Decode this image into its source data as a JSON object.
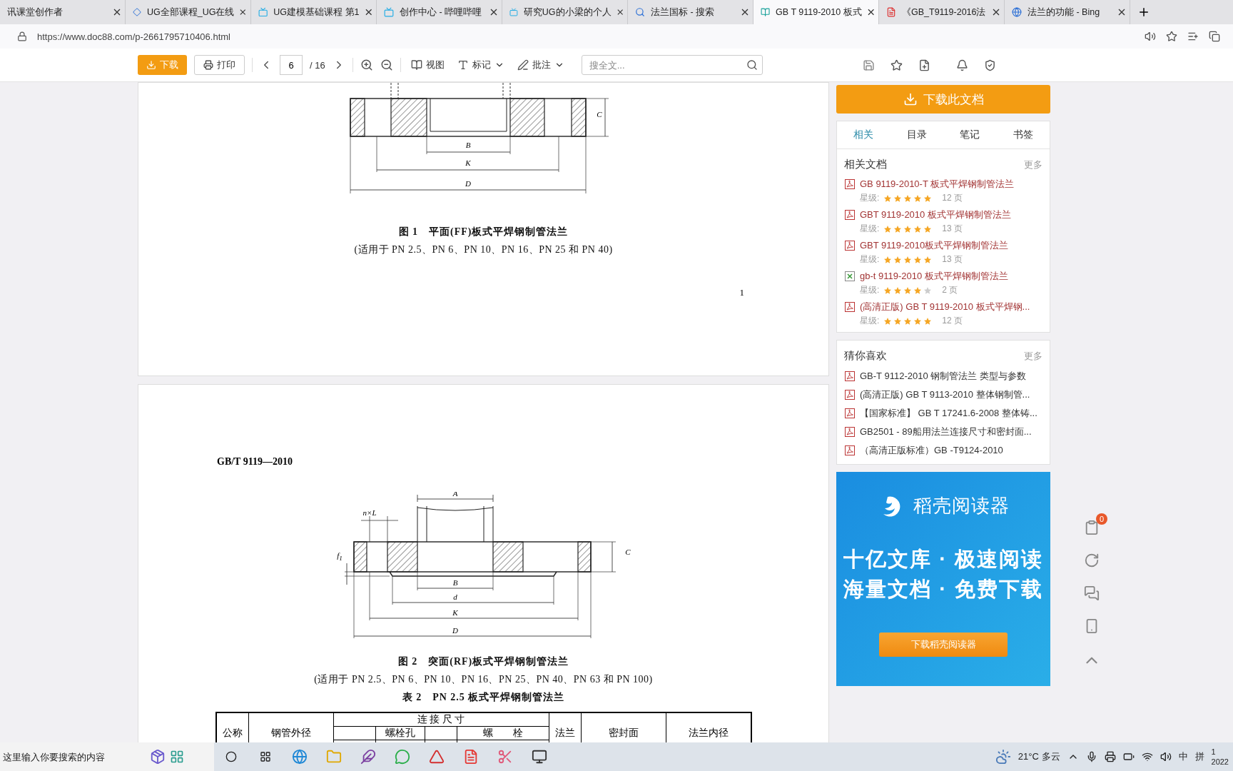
{
  "browser_tabs": [
    {
      "title": "讯课堂创作者",
      "kind": "plain",
      "selected": false
    },
    {
      "title": "UG全部课程_UG在线",
      "kind": "course",
      "selected": false
    },
    {
      "title": "UG建模基础课程 第1",
      "kind": "video",
      "selected": false
    },
    {
      "title": "创作中心 - 哔哩哔哩",
      "kind": "video",
      "selected": false
    },
    {
      "title": "研究UG的小梁的个人",
      "kind": "video",
      "selected": false
    },
    {
      "title": "法兰国标 - 搜索",
      "kind": "search",
      "selected": false
    },
    {
      "title": "GB T 9119-2010 板式",
      "kind": "doc",
      "selected": true
    },
    {
      "title": "《GB_T9119-2016法",
      "kind": "pdf",
      "selected": false
    },
    {
      "title": "法兰的功能 - Bing",
      "kind": "bing",
      "selected": false
    }
  ],
  "address_bar": {
    "url": "https://www.doc88.com/p-2661795710406.html"
  },
  "toolbar": {
    "download": "下载",
    "print": "打印",
    "page": "6",
    "page_total": "/ 16",
    "view": "视图",
    "mark": "标记",
    "annotate": "批注",
    "search_placeholder": "搜全文..."
  },
  "document": {
    "page1": {
      "figure_labels": [
        "B",
        "K",
        "D",
        "C"
      ],
      "caption": "图 1　平面(FF)板式平焊钢制管法兰",
      "subcaption": "(适用于 PN 2.5、PN 6、PN 10、PN 16、PN 25 和 PN 40)",
      "page_number": "1"
    },
    "page2": {
      "header": "GB/T 9119—2010",
      "figure_labels": [
        "A",
        "n×L",
        "f$_{1}$",
        "C",
        "B",
        "d",
        "K",
        "D"
      ],
      "caption": "图 2　突面(RF)板式平焊钢制管法兰",
      "subcaption": "(适用于 PN 2.5、PN 6、PN 10、PN 16、PN 25、PN 40、PN 63 和 PN 100)",
      "table_title": "表 2　PN 2.5 板式平焊钢制管法兰",
      "table_header": {
        "nominal": "公称",
        "pipe_od": "钢管外径",
        "connection": "连 接 尺 寸",
        "bolt_hole": "螺栓孔",
        "bolt": "螺　　栓",
        "flange": "法兰",
        "sealing": "密封面",
        "flange_id": "法兰内径"
      }
    }
  },
  "sidebar": {
    "download_button": "下载此文档",
    "tabs": [
      {
        "label": "相关",
        "selected": true
      },
      {
        "label": "目录",
        "selected": false
      },
      {
        "label": "笔记",
        "selected": false
      },
      {
        "label": "书签",
        "selected": false
      }
    ],
    "related": {
      "title": "相关文档",
      "more": "更多",
      "items": [
        {
          "title": "GB 9119-2010-T 板式平焊钢制管法兰",
          "kind": "pdf",
          "rating_label": "星级:",
          "stars": 5,
          "pages": "12 页"
        },
        {
          "title": "GBT 9119-2010 板式平焊钢制管法兰",
          "kind": "pdf",
          "rating_label": "星级:",
          "stars": 5,
          "pages": "13 页"
        },
        {
          "title": "GBT 9119-2010板式平焊钢制管法兰",
          "kind": "pdf",
          "rating_label": "星级:",
          "stars": 5,
          "pages": "13 页"
        },
        {
          "title": "gb-t 9119-2010 板式平焊钢制管法兰",
          "kind": "sheet",
          "rating_label": "星级:",
          "stars": 4,
          "pages": "2 页"
        },
        {
          "title": "(高清正版) GB T 9119-2010 板式平焊钢...",
          "kind": "pdf",
          "rating_label": "星级:",
          "stars": 5,
          "pages": "12 页"
        }
      ]
    },
    "guess": {
      "title": "猜你喜欢",
      "more": "更多",
      "items": [
        {
          "title": "GB-T 9112-2010 钢制管法兰 类型与参数"
        },
        {
          "title": "(高清正版) GB T 9113-2010 整体钢制管..."
        },
        {
          "title": "【国家标准】 GB T 17241.6-2008 整体铸..."
        },
        {
          "title": "GB2501 - 89船用法兰连接尺寸和密封面..."
        },
        {
          "title": "（高清正版标准）GB -T9124-2010"
        }
      ]
    },
    "ad": {
      "brand": "稻壳阅读器",
      "line1": "十亿文库 · 极速阅读",
      "line2": "海量文档 · 免费下载",
      "button": "下载稻壳阅读器"
    }
  },
  "float_tools": {
    "badge": "0"
  },
  "taskbar": {
    "placeholder": "这里输入你要搜索的内容",
    "weather": "21°C 多云",
    "ime": [
      "中",
      "拼"
    ],
    "clock": [
      "1",
      "2022"
    ]
  }
}
